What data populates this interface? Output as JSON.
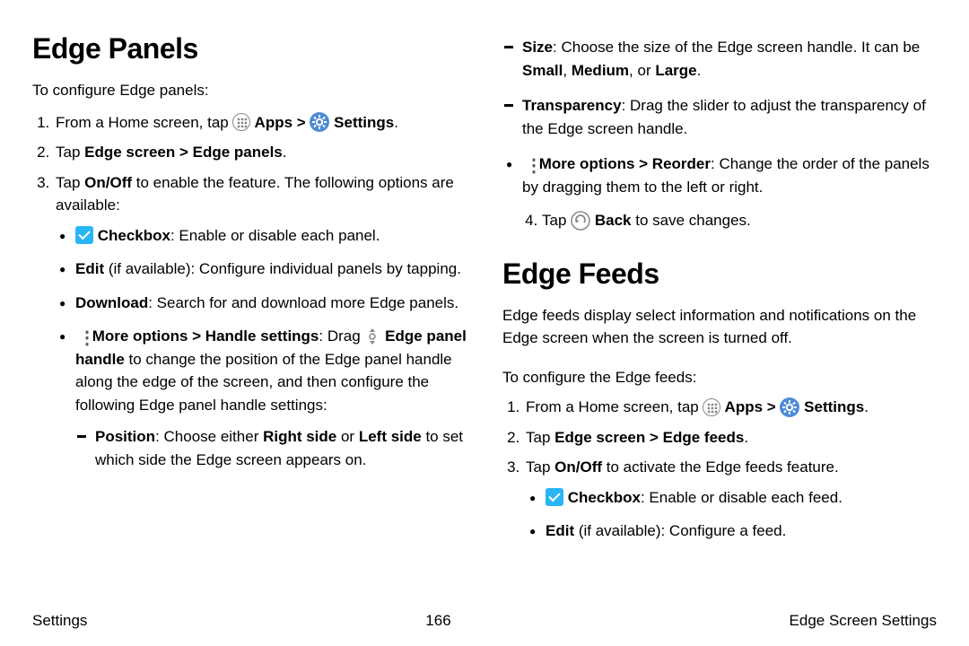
{
  "left": {
    "heading": "Edge Panels",
    "intro": "To configure Edge panels:",
    "step1_a": "From a Home screen, tap ",
    "step1_apps": " Apps > ",
    "step1_settings": " Settings",
    "step1_end": ".",
    "step2_a": "Tap ",
    "step2_b": "Edge screen > Edge panels",
    "step2_c": ".",
    "step3_a": "Tap ",
    "step3_b": "On/Off",
    "step3_c": " to enable the feature. The following options are available:",
    "b_check_b": " Checkbox",
    "b_check_t": ": Enable or disable each panel.",
    "b_edit_b": "Edit",
    "b_edit_t": " (if available): Configure individual panels by tapping.",
    "b_dl_b": "Download",
    "b_dl_t": ": Search for and download more Edge panels.",
    "b_more_b": " More options > Handle settings",
    "b_more_t1": ": Drag ",
    "b_more_handle_b": " Edge panel handle",
    "b_more_t2": " to change the position of the Edge panel handle along the edge of the screen, and then configure the following Edge panel handle settings:",
    "d_pos_b": "Position",
    "d_pos_t1": ": Choose either ",
    "d_pos_b2": "Right side",
    "d_pos_t2": " or ",
    "d_pos_b3": "Left side",
    "d_pos_t3": " to set which side the Edge screen appears on."
  },
  "right": {
    "d_size_b": "Size",
    "d_size_t1": ": Choose the size of the Edge screen handle. It can be ",
    "d_size_b2": "Small",
    "d_size_t2": ", ",
    "d_size_b3": "Medium",
    "d_size_t3": ", or ",
    "d_size_b4": "Large",
    "d_size_t4": ".",
    "d_trans_b": "Transparency",
    "d_trans_t": ": Drag the slider to adjust the transparency of the Edge screen handle.",
    "b_reorder_b": " More options > Reorder",
    "b_reorder_t": ": Change the order of the panels by dragging them to the left or right.",
    "step4_a": "Tap ",
    "step4_b": " Back",
    "step4_c": " to save changes.",
    "feeds_h": "Edge Feeds",
    "feeds_intro": "Edge feeds display select information and notifications on the Edge screen when the screen is turned off.",
    "feeds_conf": "To configure the Edge feeds:",
    "f1_a": "From a Home screen, tap ",
    "f1_apps": " Apps > ",
    "f1_settings": " Settings",
    "f1_end": ".",
    "f2_a": "Tap ",
    "f2_b": "Edge screen > Edge feeds",
    "f2_c": ".",
    "f3_a": "Tap ",
    "f3_b": "On/Off",
    "f3_c": " to activate the Edge feeds feature.",
    "fb_check_b": " Checkbox",
    "fb_check_t": ": Enable or disable each feed.",
    "fb_edit_b": "Edit",
    "fb_edit_t": " (if available): Configure a feed."
  },
  "footer": {
    "left": "Settings",
    "center": "166",
    "right": "Edge Screen Settings"
  }
}
